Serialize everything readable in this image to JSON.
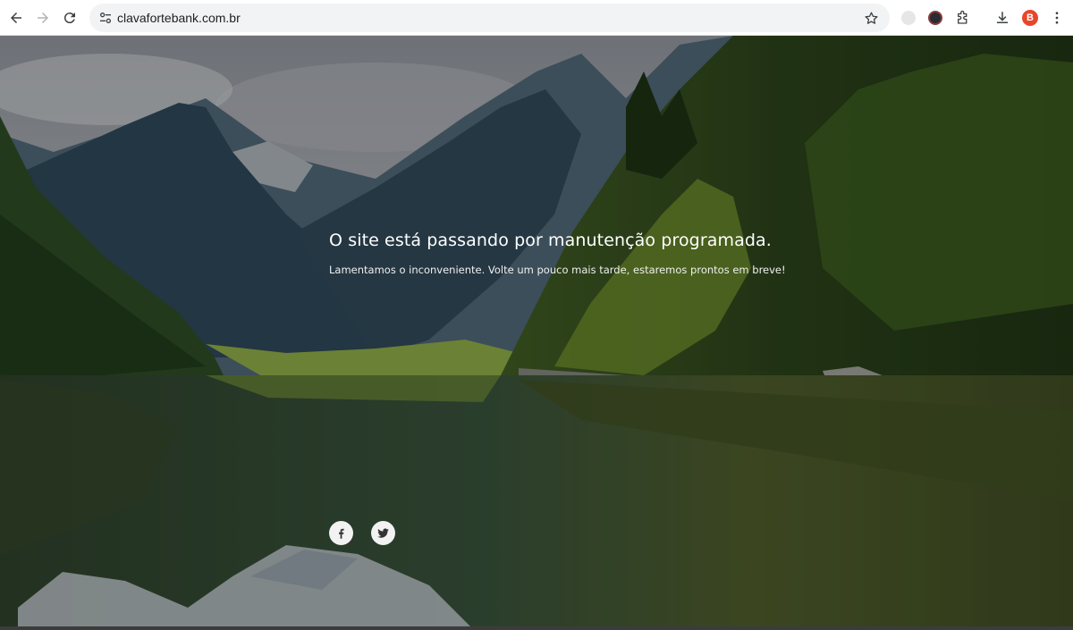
{
  "browser": {
    "url": "clavafortebank.com.br",
    "profile_initial": "B",
    "icons": {
      "back": "back-arrow-icon",
      "forward": "forward-arrow-icon",
      "reload": "reload-icon",
      "site_info": "tune-icon",
      "bookmark": "star-icon",
      "extensions": "puzzle-icon",
      "downloads": "download-icon",
      "menu": "kebab-menu-icon"
    },
    "colors": {
      "profile": "#e8462b",
      "toolbar": "#ffffff",
      "omnibox": "#f1f3f4"
    }
  },
  "page": {
    "headline": "O site está passando por manutenção programada.",
    "subtext": "Lamentamos o inconveniente. Volte um pouco mais tarde, estaremos prontos em breve!",
    "social": [
      {
        "name": "facebook",
        "icon": "facebook-icon"
      },
      {
        "name": "twitter",
        "icon": "twitter-icon"
      }
    ]
  }
}
